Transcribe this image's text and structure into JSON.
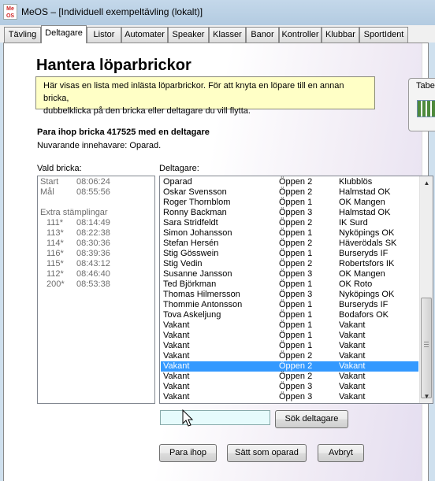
{
  "window": {
    "icon_text": "Me OS",
    "title": "MeOS – [Individuell exempeltävling (lokalt)]"
  },
  "tabs": [
    {
      "label": "Tävling"
    },
    {
      "label": "Deltagare"
    },
    {
      "label": "Listor"
    },
    {
      "label": "Automater"
    },
    {
      "label": "Speaker"
    },
    {
      "label": "Klasser"
    },
    {
      "label": "Banor"
    },
    {
      "label": "Kontroller"
    },
    {
      "label": "Klubbar"
    },
    {
      "label": "SportIdent"
    }
  ],
  "page": {
    "heading": "Hantera löparbrickor",
    "info_line1": "Här visas en lista med inlästa löparbrickor. För att knyta en löpare till en annan bricka,",
    "info_line2": "dubbelklicka på den bricka eller deltagare du vill flytta.",
    "side_widget_label": "Tabe",
    "pair_title": "Para ihop bricka 417525 med en deltagare",
    "owner_text": "Nuvarande innehavare: Oparad.",
    "left_label": "Vald bricka:",
    "right_label": "Deltagare:",
    "punches": {
      "start_label": "Start",
      "start_time": "08:06:24",
      "finish_label": "Mål",
      "finish_time": "08:55:56",
      "extra_label": "Extra stämplingar",
      "extra": [
        {
          "code": "111*",
          "time": "08:14:49"
        },
        {
          "code": "113*",
          "time": "08:22:38"
        },
        {
          "code": "114*",
          "time": "08:30:36"
        },
        {
          "code": "116*",
          "time": "08:39:36"
        },
        {
          "code": "115*",
          "time": "08:43:12"
        },
        {
          "code": "112*",
          "time": "08:46:40"
        },
        {
          "code": "200*",
          "time": "08:53:38"
        }
      ]
    },
    "runners": [
      {
        "name": "Oparad",
        "class": "Öppen 2",
        "club": "Klubblös"
      },
      {
        "name": "Oskar Svensson",
        "class": "Öppen 2",
        "club": "Halmstad OK"
      },
      {
        "name": "Roger Thornblom",
        "class": "Öppen 1",
        "club": "OK Mangen"
      },
      {
        "name": "Ronny Backman",
        "class": "Öppen 3",
        "club": "Halmstad OK"
      },
      {
        "name": "Sara Stridfeldt",
        "class": "Öppen 2",
        "club": "IK Surd"
      },
      {
        "name": "Simon Johansson",
        "class": "Öppen 1",
        "club": "Nyköpings OK"
      },
      {
        "name": "Stefan Hersén",
        "class": "Öppen 2",
        "club": "Häverödals SK"
      },
      {
        "name": "Stig Gösswein",
        "class": "Öppen 1",
        "club": "Burseryds IF"
      },
      {
        "name": "Stig Vedin",
        "class": "Öppen 2",
        "club": "Robertsfors IK"
      },
      {
        "name": "Susanne Jansson",
        "class": "Öppen 3",
        "club": "OK Mangen"
      },
      {
        "name": "Ted Björkman",
        "class": "Öppen 1",
        "club": "OK Roto"
      },
      {
        "name": "Thomas Hilmersson",
        "class": "Öppen 3",
        "club": "Nyköpings OK"
      },
      {
        "name": "Thommie Antonsson",
        "class": "Öppen 1",
        "club": "Burseryds IF"
      },
      {
        "name": "Tova Askeljung",
        "class": "Öppen 1",
        "club": "Bodafors OK"
      },
      {
        "name": "Vakant",
        "class": "Öppen 1",
        "club": "Vakant"
      },
      {
        "name": "Vakant",
        "class": "Öppen 1",
        "club": "Vakant"
      },
      {
        "name": "Vakant",
        "class": "Öppen 1",
        "club": "Vakant"
      },
      {
        "name": "Vakant",
        "class": "Öppen 2",
        "club": "Vakant"
      },
      {
        "name": "Vakant",
        "class": "Öppen 2",
        "club": "Vakant",
        "selected": true
      },
      {
        "name": "Vakant",
        "class": "Öppen 2",
        "club": "Vakant"
      },
      {
        "name": "Vakant",
        "class": "Öppen 3",
        "club": "Vakant"
      },
      {
        "name": "Vakant",
        "class": "Öppen 3",
        "club": "Vakant"
      }
    ],
    "search": {
      "value": "",
      "button": "Sök deltagare"
    },
    "buttons": {
      "pair": "Para ihop",
      "set_unpaired": "Sätt som oparad",
      "cancel": "Avbryt"
    }
  },
  "colors": {
    "selection": "#3399ff",
    "info_bg": "#ffffc6",
    "search_bg": "#e6fbfc"
  }
}
